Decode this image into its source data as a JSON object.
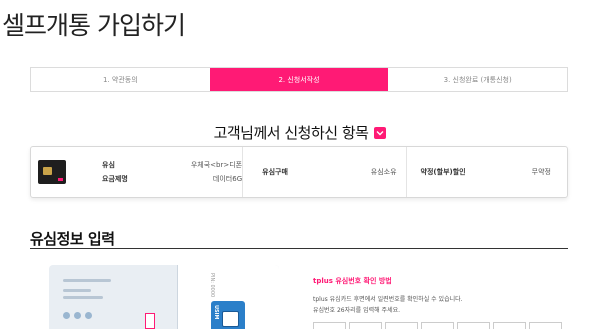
{
  "page": {
    "title": "셀프개통 가입하기"
  },
  "steps": [
    {
      "label": "1. 약관동의",
      "active": false
    },
    {
      "label": "2. 신청서작성",
      "active": true
    },
    {
      "label": "3. 신청완료 (개통신청)",
      "active": false
    }
  ],
  "summary": {
    "heading": "고객님께서 신청하신 항목",
    "plan": {
      "key_usim": "유심",
      "key_plan": "요금제명",
      "value_plan_line1": "우체국<br>디폰",
      "value_plan_line2": "데이터6G"
    },
    "usim_purchase": {
      "label": "유심구매",
      "value": "유심소유"
    },
    "contract": {
      "label": "약정(할부)할인",
      "value": "무약정"
    }
  },
  "usim_info": {
    "heading": "유심정보 입력",
    "card_pin_label": "PIN: 0000",
    "card_brand": "USIM",
    "howto_title": "tplus 유심번호 확인 방법",
    "howto_line1": "tplus 유심카드 후면에서 일련번호를 확인하실 수 있습니다.",
    "howto_line2": "유심번호 26자리를 입력해 주세요."
  },
  "colors": {
    "accent": "#ff1a75",
    "usim_blue": "#2b7fc9"
  },
  "icons": {
    "toggle": "chevron-down-icon"
  }
}
